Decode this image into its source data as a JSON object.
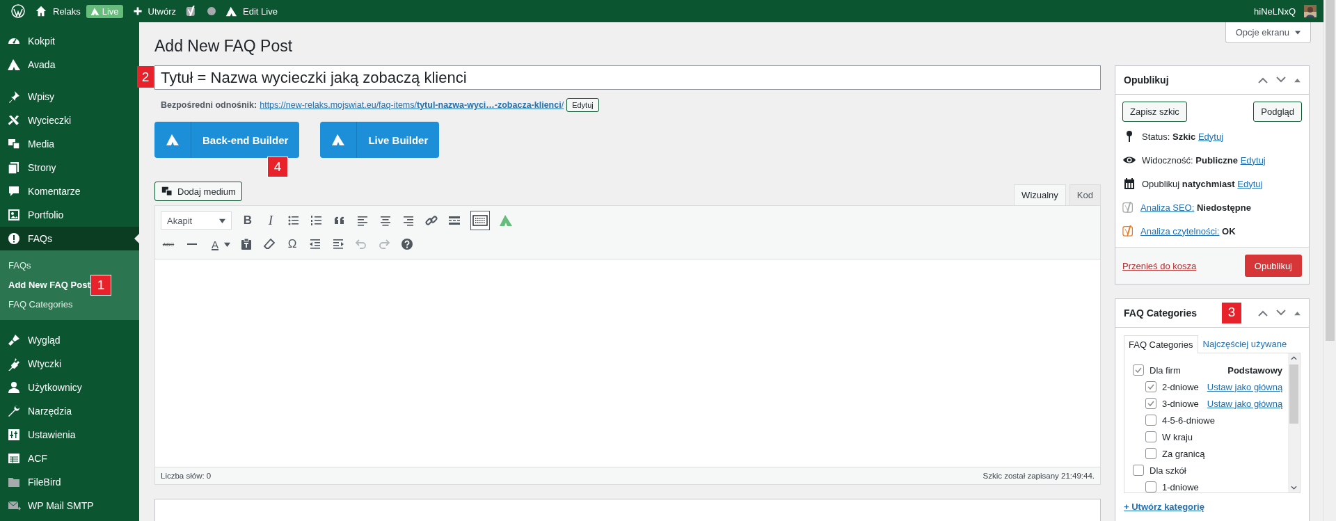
{
  "admin_bar": {
    "site": "Relaks",
    "live": "Live",
    "new": "Utwórz",
    "edit_live": "Edit Live",
    "user": "hiNeLNxQ"
  },
  "sidebar": {
    "groups": [
      {
        "items": [
          {
            "label": "Kokpit",
            "selected": false
          },
          {
            "label": "Avada",
            "selected": false
          }
        ]
      },
      {
        "items": [
          {
            "label": "Wpisy",
            "selected": false
          },
          {
            "label": "Wycieczki",
            "selected": false
          },
          {
            "label": "Media",
            "selected": false
          },
          {
            "label": "Strony",
            "selected": false
          },
          {
            "label": "Komentarze",
            "selected": false
          },
          {
            "label": "Portfolio",
            "selected": false
          },
          {
            "label": "FAQs",
            "selected": true,
            "children": [
              {
                "label": "FAQs",
                "selected": false
              },
              {
                "label": "Add New FAQ Post",
                "selected": true
              },
              {
                "label": "FAQ Categories",
                "selected": false
              }
            ]
          }
        ]
      },
      {
        "items": [
          {
            "label": "Wygląd",
            "selected": false
          },
          {
            "label": "Wtyczki",
            "selected": false
          },
          {
            "label": "Użytkownicy",
            "selected": false
          },
          {
            "label": "Narzędzia",
            "selected": false
          },
          {
            "label": "Ustawienia",
            "selected": false
          },
          {
            "label": "ACF",
            "selected": false
          },
          {
            "label": "FileBird",
            "selected": false
          },
          {
            "label": "WP Mail SMTP",
            "selected": false
          }
        ]
      }
    ]
  },
  "page": {
    "title": "Add New FAQ Post",
    "screen_options": "Opcje ekranu"
  },
  "post_title": {
    "value": "Tytuł = Nazwa wycieczki jaką zobaczą klienci"
  },
  "permalink": {
    "label": "Bezpośredni odnośnik:",
    "url": "https://new-relaks.mojswiat.eu/faq-items/**tytul-nazwa-wyci…-zobacza-klienci**/",
    "edit": "Edytuj"
  },
  "builders": [
    "Back-end Builder",
    "Live Builder"
  ],
  "markers": [
    "1",
    "2",
    "3",
    "4"
  ],
  "editor": {
    "add_media": "Dodaj medium",
    "tabs": [
      {
        "label": "Wizualny",
        "selected": true
      },
      {
        "label": "Kod",
        "selected": false
      }
    ],
    "format": "Akapit",
    "glyphs": {
      "bold": "B",
      "italic": "I",
      "strike": "ABC",
      "font": "A",
      "special": "Ω"
    },
    "toolbar_toggle_on": true,
    "undo_disabled": true,
    "redo_disabled": true,
    "word_count": "Liczba słów: 0",
    "saved": "Szkic został zapisany 21:49:44."
  },
  "publish": {
    "title": "Opublikuj",
    "save_draft": "Zapisz szkic",
    "preview": "Podgląd",
    "rows": [
      {
        "kind": "status",
        "label": "Status:",
        "value": "Szkic",
        "link": "Edytuj"
      },
      {
        "kind": "visibility",
        "label": "Widoczność:",
        "value": "Publiczne",
        "link": "Edytuj"
      },
      {
        "kind": "schedule",
        "label": "Opublikuj",
        "value": "natychmiast",
        "link": "Edytuj"
      },
      {
        "kind": "seo",
        "link": "Analiza SEO:",
        "value": "Niedostępne",
        "color": "#a7aaad"
      },
      {
        "kind": "readability",
        "link": "Analiza czytelności:",
        "value": "OK",
        "color": "#f0781e"
      }
    ],
    "trash": "Przenieś do kosza",
    "publish": "Opublikuj"
  },
  "categories": {
    "title": "FAQ Categories",
    "tabs": [
      {
        "label": "FAQ Categories",
        "selected": true
      },
      {
        "label": "Najczęściej używane",
        "selected": false
      }
    ],
    "tree": [
      {
        "label": "Dla firm",
        "checked": true,
        "badge": "Podstawowy",
        "children": [
          {
            "label": "2-dniowe",
            "checked": true,
            "action": "Ustaw jako główną"
          },
          {
            "label": "3-dniowe",
            "checked": true,
            "action": "Ustaw jako główną"
          },
          {
            "label": "4-5-6-dniowe",
            "checked": false
          },
          {
            "label": "W kraju",
            "checked": false
          },
          {
            "label": "Za granicą",
            "checked": false
          }
        ]
      },
      {
        "label": "Dla szkół",
        "checked": false,
        "children": [
          {
            "label": "1-dniowe",
            "checked": false
          }
        ]
      }
    ],
    "add": "+ Utwórz kategorię"
  }
}
